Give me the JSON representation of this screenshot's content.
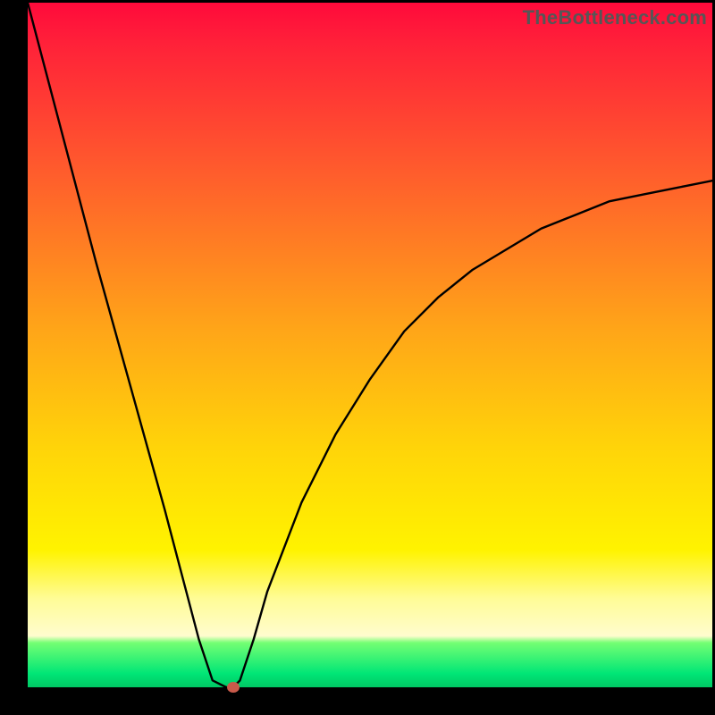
{
  "watermark": "TheBottleneck.com",
  "chart_data": {
    "type": "line",
    "title": "",
    "xlabel": "",
    "ylabel": "",
    "xlim": [
      0,
      100
    ],
    "ylim": [
      0,
      100
    ],
    "x": [
      0,
      5,
      10,
      15,
      20,
      25,
      27,
      29,
      30,
      31,
      33,
      35,
      40,
      45,
      50,
      55,
      60,
      65,
      70,
      75,
      80,
      85,
      90,
      95,
      100
    ],
    "y": [
      100,
      81,
      62,
      44,
      26,
      7,
      1,
      0,
      0,
      1,
      7,
      14,
      27,
      37,
      45,
      52,
      57,
      61,
      64,
      67,
      69,
      71,
      72,
      73,
      74
    ],
    "series": [
      {
        "name": "bottleneck-curve",
        "color": "#000000"
      }
    ],
    "marker": {
      "x": 30,
      "y": 0,
      "color": "#c85a4a"
    },
    "background_gradient": {
      "stops": [
        {
          "pos": 0,
          "color": "#ff0a3b"
        },
        {
          "pos": 0.25,
          "color": "#ff5d2c"
        },
        {
          "pos": 0.48,
          "color": "#ffa618"
        },
        {
          "pos": 0.65,
          "color": "#ffd409"
        },
        {
          "pos": 0.8,
          "color": "#fff300"
        },
        {
          "pos": 0.93,
          "color": "#fffcce"
        },
        {
          "pos": 0.94,
          "color": "#73ff73"
        },
        {
          "pos": 1.0,
          "color": "#00c864"
        }
      ]
    }
  }
}
